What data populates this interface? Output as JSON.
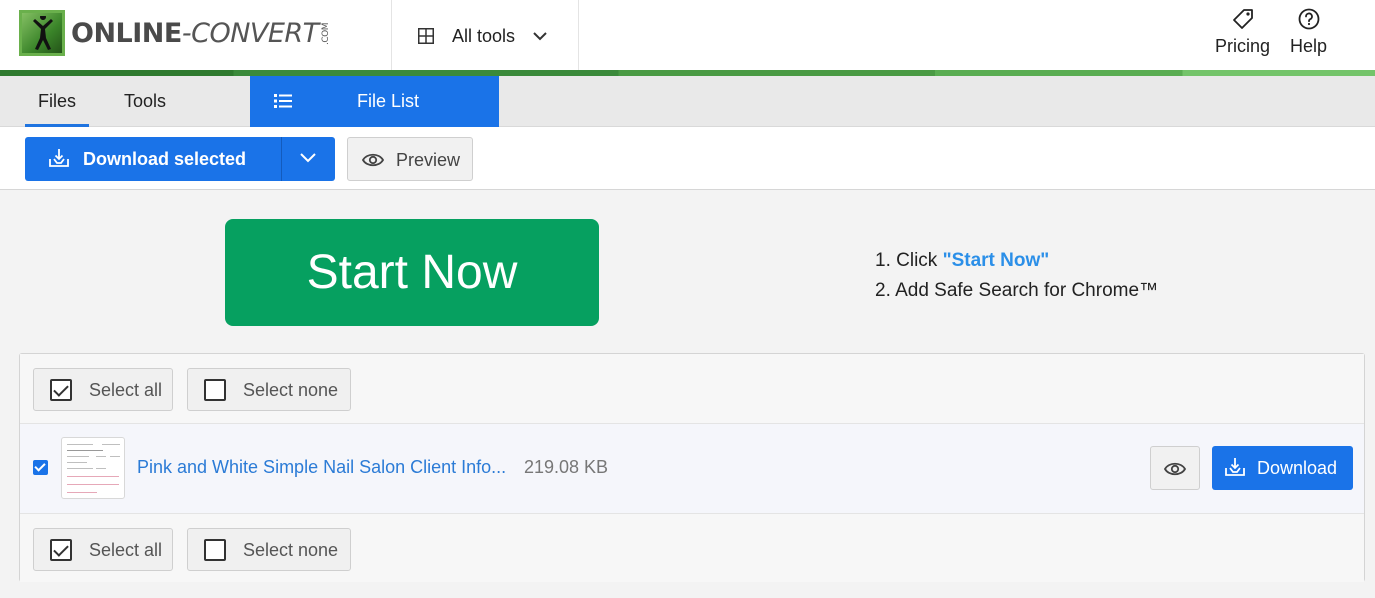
{
  "header": {
    "logo_text_1": "ONLINE",
    "logo_text_2": "-CON",
    "logo_text_3": "VERT",
    "logo_com": ".COM",
    "all_tools_label": "All tools",
    "pricing_label": "Pricing",
    "help_label": "Help"
  },
  "tabs": {
    "files_label": "Files",
    "tools_label": "Tools",
    "file_list_label": "File List"
  },
  "toolbar": {
    "download_selected_label": "Download selected",
    "preview_label": "Preview"
  },
  "ad": {
    "start_now_label": "Start Now",
    "step1_prefix": "1. Click ",
    "step1_highlight": "\"Start Now\"",
    "step2": "2. Add Safe Search for Chrome™"
  },
  "selection": {
    "select_all_label": "Select all",
    "select_none_label": "Select none"
  },
  "files": [
    {
      "name": "Pink and White Simple Nail Salon Client Info...",
      "size": "219.08 KB",
      "checked": true,
      "download_label": "Download"
    }
  ],
  "colors": {
    "primary_blue": "#1a73e8",
    "start_now_green": "#06a060",
    "link_blue": "#2b7bd6",
    "brand_green": "#3b8a3b"
  }
}
